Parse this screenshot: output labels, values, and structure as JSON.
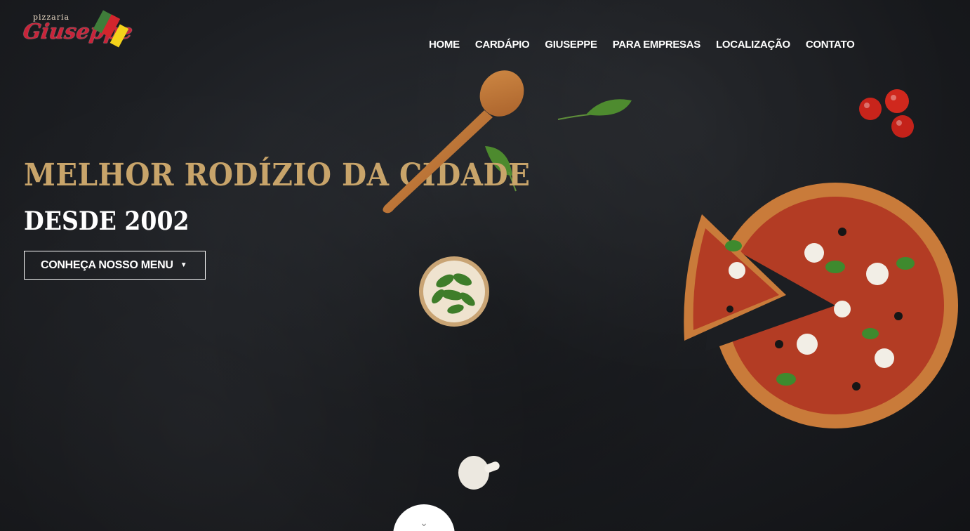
{
  "brand": {
    "small_word": "pizzaria",
    "script_word": "Giuseppe"
  },
  "nav": {
    "items": [
      "HOME",
      "CARDÁPIO",
      "GIUSEPPE",
      "PARA EMPRESAS",
      "LOCALIZAÇÃO",
      "CONTATO"
    ]
  },
  "hero": {
    "headline": "MELHOR RODÍZIO DA CIDADE",
    "subline": "DESDE 2002",
    "cta_label": "CONHEÇA NOSSO MENU",
    "cta_icon": "chevron-down-icon"
  },
  "scroll": {
    "icon": "double-chevron-down-icon",
    "glyph": "⌄"
  },
  "colors": {
    "accent_gold": "#c8a46a",
    "background": "#1c1e22",
    "logo_red": "#c8243a"
  }
}
